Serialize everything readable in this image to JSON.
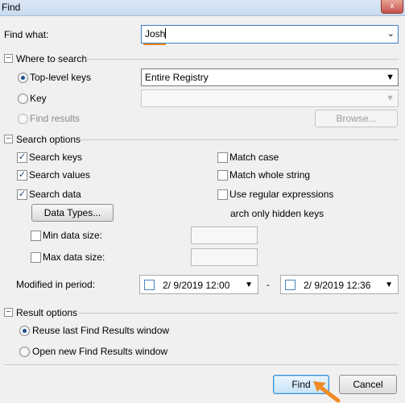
{
  "window": {
    "title": "Find",
    "close_glyph": "x"
  },
  "find_what": {
    "label": "Find what:",
    "value": "Josh"
  },
  "where_to_search": {
    "header": "Where to search",
    "top_level_keys": {
      "label": "Top-level keys",
      "selected": "Entire Registry"
    },
    "key": {
      "label": "Key",
      "value": ""
    },
    "find_results": {
      "label": "Find results",
      "browse_label": "Browse..."
    }
  },
  "search_options": {
    "header": "Search options",
    "search_keys": "Search keys",
    "search_values": "Search values",
    "search_data": "Search data",
    "data_types_label": "Data Types...",
    "min_data_size": "Min data size:",
    "max_data_size": "Max data size:",
    "match_case": "Match case",
    "match_whole_string": "Match whole string",
    "use_regular_expressions": "Use regular expressions",
    "only_hidden_keys": "arch only hidden keys",
    "modified_in_period": "Modified in period:",
    "date_from": "2/ 9/2019 12:00",
    "date_separator": "-",
    "date_to": "2/ 9/2019 12:36"
  },
  "result_options": {
    "header": "Result options",
    "reuse_window": "Reuse last Find Results window",
    "open_new_window": "Open new Find Results window"
  },
  "buttons": {
    "find": "Find",
    "cancel": "Cancel"
  },
  "colors": {
    "accent_underline": "#f0891e",
    "pointer_arrow": "#f08a24",
    "default_button_border": "#3a8fd6"
  }
}
